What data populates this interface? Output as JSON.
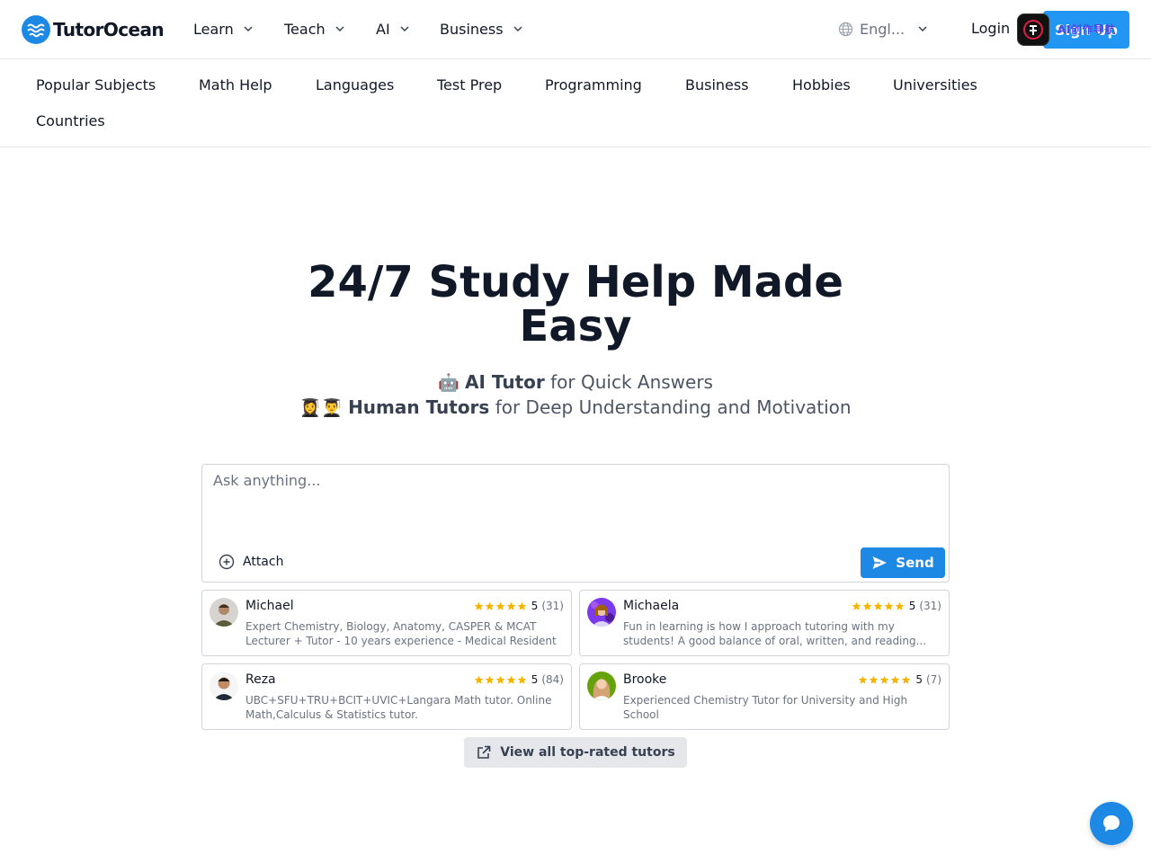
{
  "header": {
    "brand": "TutorOcean",
    "nav": [
      {
        "label": "Learn"
      },
      {
        "label": "Teach"
      },
      {
        "label": "AI"
      },
      {
        "label": "Business"
      }
    ],
    "language": "Engl...",
    "login": "Login",
    "signup": "Sign Up",
    "extension_text": "AI创作导航"
  },
  "categories": [
    "Popular Subjects",
    "Math Help",
    "Languages",
    "Test Prep",
    "Programming",
    "Business",
    "Hobbies",
    "Universities",
    "Countries"
  ],
  "hero": {
    "title": "24/7 Study Help Made Easy",
    "line1_emoji": "🤖",
    "line1_bold": "AI Tutor",
    "line1_rest": "for Quick Answers",
    "line2_emoji": "👩‍🎓👨‍🎓",
    "line2_bold": "Human Tutors",
    "line2_rest": "for Deep Understanding and Motivation"
  },
  "ask": {
    "placeholder": "Ask anything...",
    "attach_label": "Attach",
    "send_label": "Send"
  },
  "tutors": [
    {
      "name": "Michael",
      "rating": "5",
      "reviews": "(31)",
      "stars": 5,
      "description": "Expert Chemistry, Biology, Anatomy, CASPER & MCAT Lecturer + Tutor - 10 years experience - Medical Resident"
    },
    {
      "name": "Michaela",
      "rating": "5",
      "reviews": "(31)",
      "stars": 5,
      "description": "Fun in learning is how I approach tutoring with my students! A good balance of oral, written, and reading..."
    },
    {
      "name": "Reza",
      "rating": "5",
      "reviews": "(84)",
      "stars": 5,
      "description": "UBC+SFU+TRU+BCIT+UVIC+Langara Math tutor. Online Math,Calculus & Statistics tutor."
    },
    {
      "name": "Brooke",
      "rating": "5",
      "reviews": "(7)",
      "stars": 5,
      "description": "Experienced Chemistry Tutor for University and High School"
    }
  ],
  "view_all": "View all top-rated tutors",
  "colors": {
    "primary": "#1e88e5",
    "star": "#f5b400",
    "text": "#111827",
    "muted": "#6b7280"
  }
}
